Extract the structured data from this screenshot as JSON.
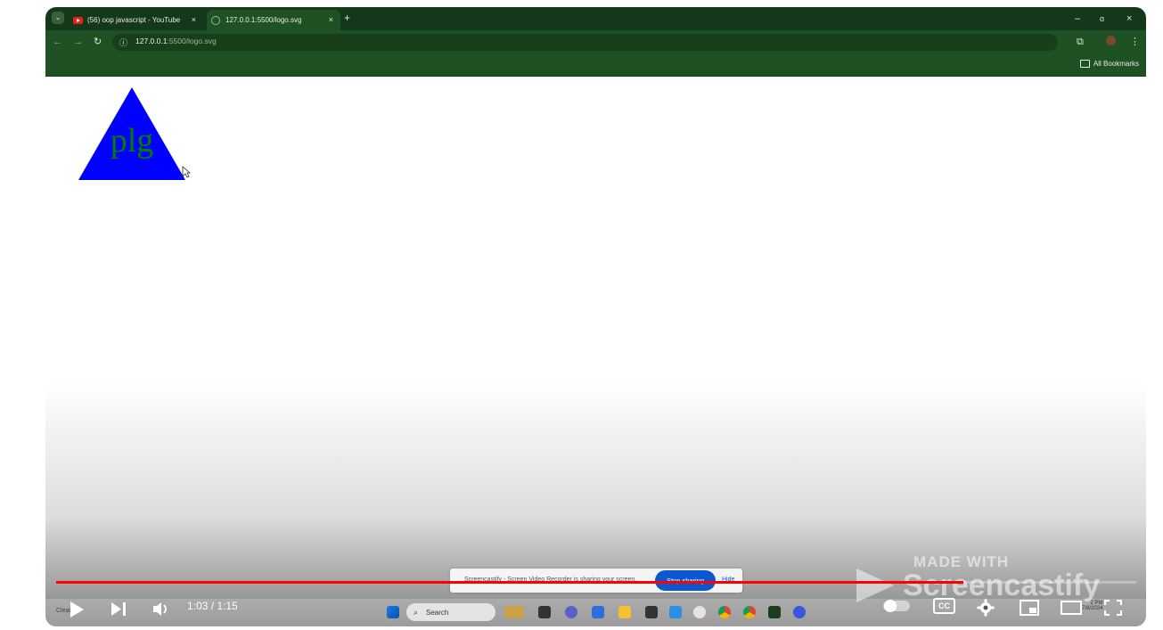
{
  "browser": {
    "tabs": [
      {
        "label": "(56) oop javascript - YouTube",
        "close": "×"
      },
      {
        "label": "127.0.0.1:5500/logo.svg",
        "close": "×"
      }
    ],
    "new_tab": "+",
    "url_host": "127.0.0.1",
    "url_path": ":5500/logo.svg",
    "bookmarks_label": "All Bookmarks",
    "window_controls": {
      "minimize": "–",
      "restore": "ɑ",
      "close": "×"
    }
  },
  "page": {
    "logo_text": "plg",
    "logo_fill": "#0000ff",
    "logo_text_color": "#008000"
  },
  "screencastify": {
    "share_text": "Screencastify - Screen Video Recorder is sharing your screen.",
    "stop_label": "Stop sharing",
    "hide_label": "Hide",
    "watermark_small": "MADE WITH",
    "watermark_big": "Screencastify"
  },
  "taskbar": {
    "search_label": "Search",
    "weather": "Clear",
    "time": "2 PM",
    "date": "7/8/2024"
  },
  "player": {
    "current_time": "1:03",
    "duration": "1:15",
    "time_display": "1:03 / 1:15",
    "progress": 0.84,
    "cc_label": "CC",
    "accent": "#ff0000"
  }
}
